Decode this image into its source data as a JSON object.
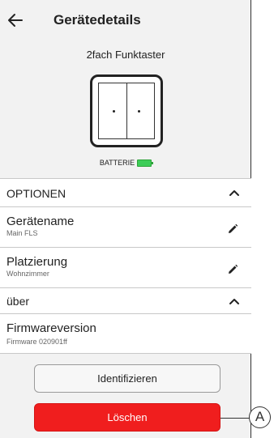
{
  "header": {
    "title": "Gerätedetails"
  },
  "device": {
    "name": "2fach Funktaster",
    "battery_label": "BATTERIE"
  },
  "options": {
    "label": "OPTIONEN"
  },
  "device_name": {
    "label": "Gerätename",
    "value": "Main FLS"
  },
  "placement": {
    "label": "Platzierung",
    "value": "Wohnzimmer"
  },
  "about": {
    "label": "über"
  },
  "firmware": {
    "label": "Firmwareversion",
    "value": "Firmware 020901ff"
  },
  "buttons": {
    "identify": "Identifizieren",
    "delete": "Löschen"
  },
  "callout": {
    "letter": "A"
  },
  "colors": {
    "delete": "#f01e1e",
    "battery": "#3dcd58"
  },
  "icons": [
    "back-arrow-icon",
    "chevron-up-icon",
    "pencil-icon",
    "battery-icon"
  ]
}
